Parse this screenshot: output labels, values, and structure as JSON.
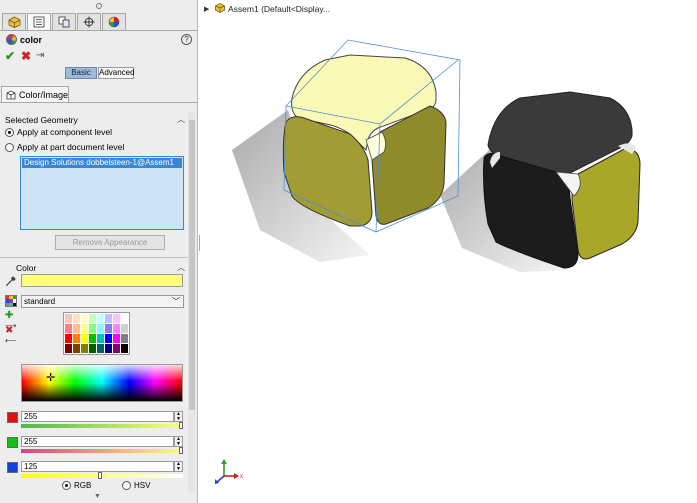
{
  "panel": {
    "tabs": [
      {
        "name": "feature-manager-tab",
        "icon": "feature-tree-icon"
      },
      {
        "name": "property-manager-tab",
        "icon": "property-manager-icon"
      },
      {
        "name": "configuration-manager-tab",
        "icon": "configuration-icon"
      },
      {
        "name": "dimxpert-tab",
        "icon": "crosshair-icon"
      },
      {
        "name": "display-manager-tab",
        "icon": "appearance-pie-icon"
      }
    ],
    "title": "color",
    "help": "?",
    "mode_buttons": {
      "basic": "Basic",
      "advanced": "Advanced"
    },
    "sub_tab": "Color/Image"
  },
  "selected_geometry": {
    "header": "Selected Geometry",
    "options": [
      "Apply at component level",
      "Apply at part document level"
    ],
    "selected_option": "Apply at component level",
    "list_items": [
      "Design Solutions dobbelsteen-1@Assem1"
    ],
    "remove_button": "Remove Appearance"
  },
  "color": {
    "header": "Color",
    "current_color": "#ffff7d",
    "palette": "standard",
    "swatches": [
      "#ffc0c0",
      "#ffe0c0",
      "#ffffc0",
      "#c0ffc0",
      "#c0ffff",
      "#c0c0ff",
      "#ffc0ff",
      "#ffffff",
      "#ff8080",
      "#ffc080",
      "#ffff80",
      "#80ff80",
      "#80ffff",
      "#8080ff",
      "#ff80ff",
      "#d0d0d0",
      "#ff0000",
      "#ff8000",
      "#ffff00",
      "#00c000",
      "#00c0c0",
      "#0000ff",
      "#ff00ff",
      "#808080",
      "#800000",
      "#804000",
      "#808000",
      "#006000",
      "#006060",
      "#000080",
      "#800080",
      "#000000"
    ],
    "red": 255,
    "green": 255,
    "blue": 125,
    "red_value": "255",
    "green_value": "255",
    "blue_value": "125",
    "model_options": {
      "rgb": "RGB",
      "hsv": "HSV"
    },
    "selected_model": "RGB"
  },
  "viewport": {
    "tree_label": "Assem1  (Default<Display..."
  }
}
